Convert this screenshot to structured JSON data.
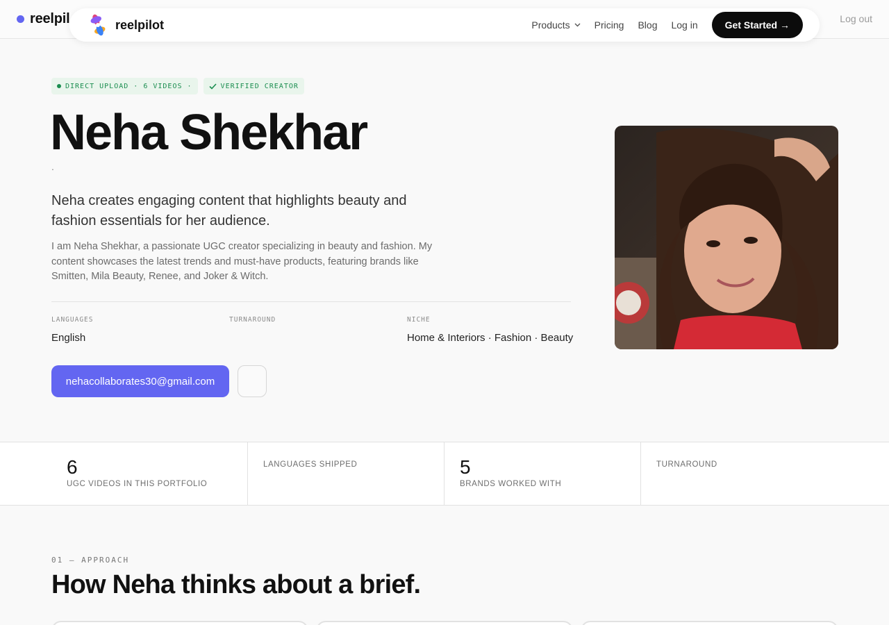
{
  "topbar": {
    "brand": "reelpil",
    "logout_label": "Log out"
  },
  "nav": {
    "logo_text": "reelpilot",
    "products_label": "Products",
    "pricing_label": "Pricing",
    "blog_label": "Blog",
    "login_label": "Log in",
    "cta_label": "Get Started →"
  },
  "hero": {
    "badge_upload": "DIRECT UPLOAD · 6 VIDEOS ·",
    "badge_verified": "VERIFIED CREATOR",
    "name": "Neha Shekhar",
    "dot": ".",
    "tagline": "Neha creates engaging content that highlights beauty and fashion essentials for her audience.",
    "bio": "I am Neha Shekhar, a passionate UGC creator specializing in beauty and fashion. My content showcases the latest trends and must-have products, featuring brands like Smitten, Mila Beauty, Renee, and Joker & Witch.",
    "languages_label": "LANGUAGES",
    "languages_value": "English",
    "turnaround_label": "TURNAROUND",
    "turnaround_value": "",
    "niche_label": "NICHE",
    "niche_value": "Home & Interiors · Fashion · Beauty",
    "email": "nehacollaborates30@gmail.com"
  },
  "stats": [
    {
      "value": "6",
      "label": "UGC VIDEOS IN THIS PORTFOLIO"
    },
    {
      "value": "",
      "label": "LANGUAGES SHIPPED"
    },
    {
      "value": "5",
      "label": "BRANDS WORKED WITH"
    },
    {
      "value": "",
      "label": "TURNAROUND"
    }
  ],
  "approach": {
    "eyebrow": "01 — APPROACH",
    "heading": "How Neha thinks about a brief."
  },
  "colors": {
    "accent": "#6366f1",
    "verified_green": "#1a8d4f",
    "cta_black": "#0c0c0c"
  }
}
